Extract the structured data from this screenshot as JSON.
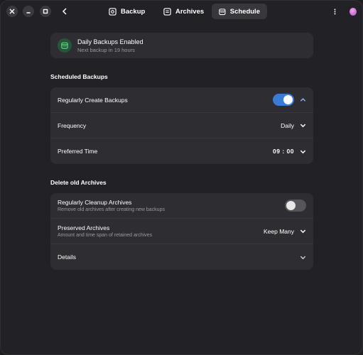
{
  "header": {
    "tabs": [
      {
        "label": "Backup",
        "icon": "backup-icon",
        "active": false
      },
      {
        "label": "Archives",
        "icon": "archives-icon",
        "active": false
      },
      {
        "label": "Schedule",
        "icon": "calendar-icon",
        "active": true
      }
    ]
  },
  "status": {
    "title": "Daily Backups Enabled",
    "subtitle": "Next backup in 19 hours",
    "icon": "calendar-check-icon"
  },
  "scheduled": {
    "title": "Scheduled Backups",
    "rows": [
      {
        "label": "Regularly Create Backups",
        "toggle": "on"
      },
      {
        "label": "Frequency",
        "value": "Daily"
      },
      {
        "label": "Preferred Time",
        "value": "09 : 00"
      }
    ]
  },
  "delete": {
    "title": "Delete old Archives",
    "rows": [
      {
        "label": "Regularly Cleanup Archives",
        "sublabel": "Remove old archives after creating new backups",
        "toggle": "off"
      },
      {
        "label": "Preserved Archives",
        "sublabel": "Amount and time span of retained archives",
        "value": "Keep Many"
      },
      {
        "label": "Details"
      }
    ]
  },
  "colors": {
    "accent": "#3a7bd5",
    "card": "#2e2e32",
    "background": "#222226",
    "status_icon_bg": "#26563a",
    "status_icon_fg": "#6fdc8c"
  }
}
